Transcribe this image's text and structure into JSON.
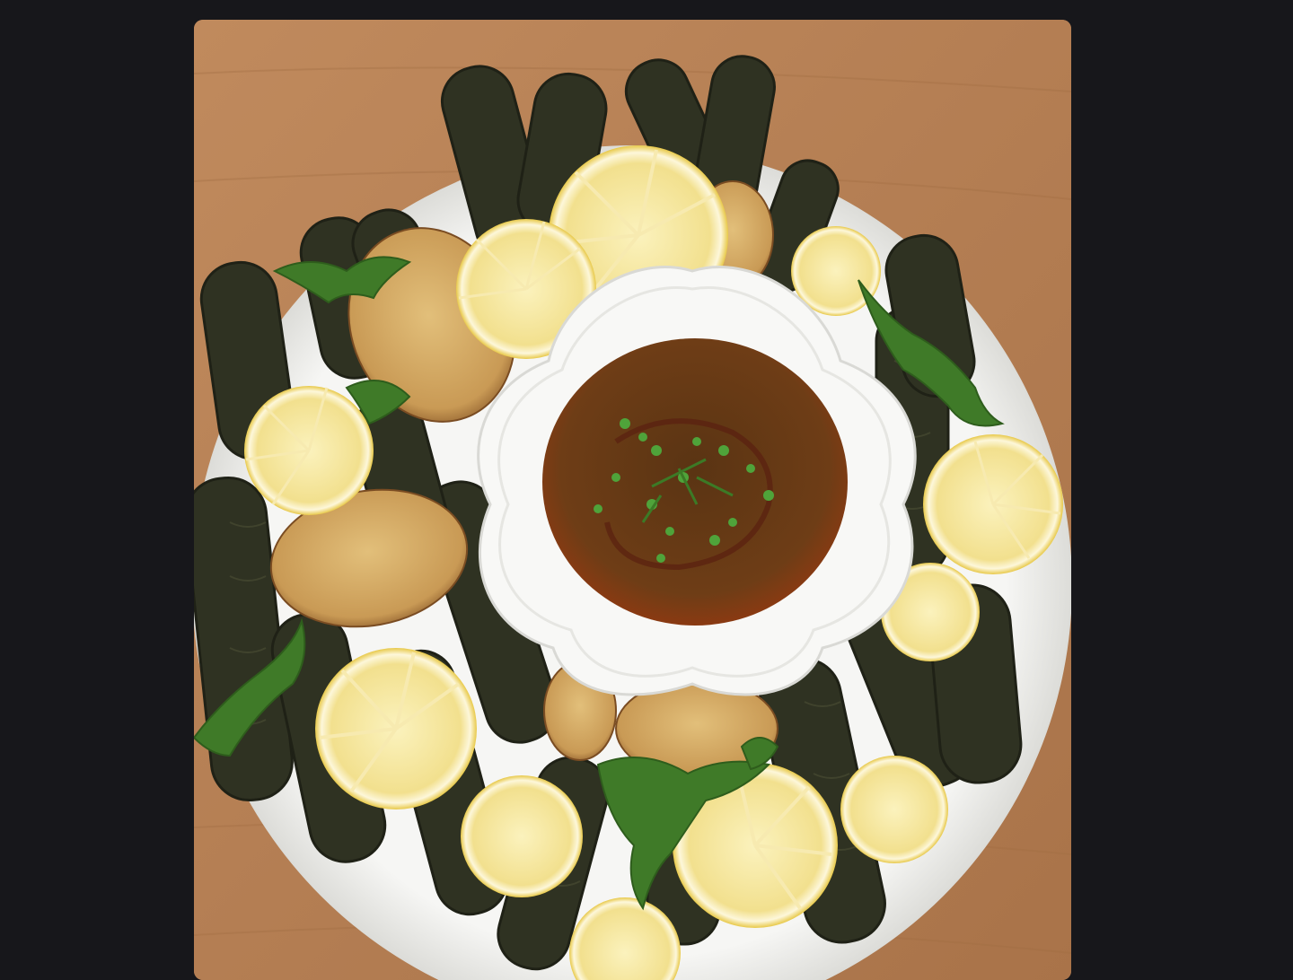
{
  "viewer": {
    "background_color": "#17171b"
  },
  "photo": {
    "subject_icon": "stuffed-grape-leaves-platter",
    "colors": {
      "table": "#b98357",
      "plate": "#f4f4f2",
      "leaf_roll": "#2f3222",
      "lemon": "#f3e39a",
      "potato": "#d2a763",
      "sauce": "#6a3a16",
      "herb": "#4b8a2e"
    }
  }
}
